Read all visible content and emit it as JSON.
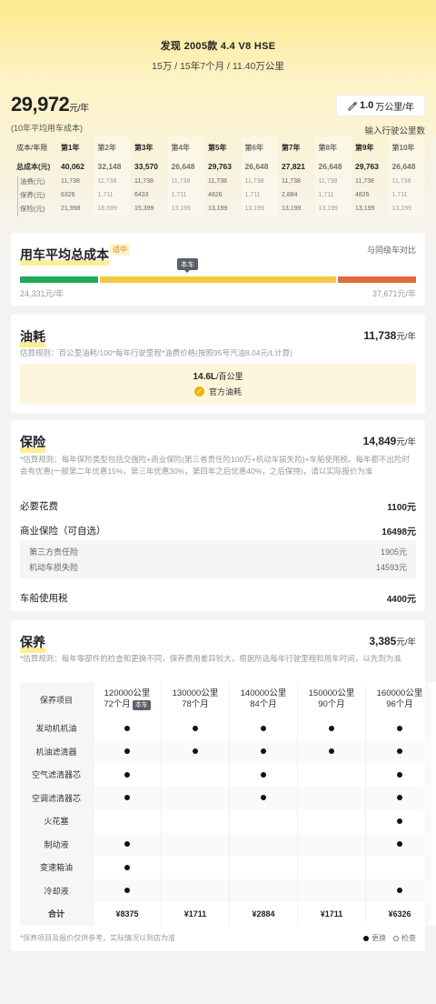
{
  "header": {
    "title": "发现 2005款 4.4 V8 HSE",
    "subtitle": "15万 / 15年7个月 / 11.40万公里"
  },
  "summary": {
    "total_cost": "29,972",
    "total_unit": "元/年",
    "note": "(10年平均用车成本)",
    "km_value": "1.0",
    "km_unit": "万公里/年",
    "km_hint": "输入行驶公里数"
  },
  "year_table": {
    "corner": "成本/年限",
    "years": [
      "第1年",
      "第2年",
      "第3年",
      "第4年",
      "第5年",
      "第6年",
      "第7年",
      "第8年",
      "第9年",
      "第10年"
    ],
    "rows": [
      {
        "label": "总成本(元)",
        "values": [
          "40,062",
          "32,148",
          "33,570",
          "26,648",
          "29,763",
          "26,648",
          "27,821",
          "26,648",
          "29,763",
          "26,648"
        ]
      },
      {
        "label": "油费(元)",
        "values": [
          "11,738",
          "11,738",
          "11,738",
          "11,738",
          "11,738",
          "11,738",
          "11,738",
          "11,738",
          "11,738",
          "11,738"
        ]
      },
      {
        "label": "保养(元)",
        "values": [
          "6326",
          "1,711",
          "6433",
          "1,711",
          "4826",
          "1,711",
          "2,884",
          "1,711",
          "4826",
          "1,711"
        ]
      },
      {
        "label": "保险(元)",
        "values": [
          "21,998",
          "18,699",
          "15,399",
          "13,199",
          "13,199",
          "13,199",
          "13,199",
          "13,199",
          "13,199",
          "13,199"
        ]
      }
    ]
  },
  "avg_card": {
    "title": "用车平均总成本",
    "tag": "适中",
    "compare": "与同级车对比",
    "current_chip": "本车",
    "low": "24,331元/年",
    "high": "37,671元/年",
    "colors": {
      "low": "#22a85a",
      "mid": "#f5c842",
      "high": "#e06a3a"
    },
    "position": 0.44
  },
  "fuel_card": {
    "title": "油耗",
    "value": "11,738",
    "unit": "元/年",
    "rule": "估算规则：百公里油耗/100*每年行驶里程*油费价格(按照95号汽油8.04元/L计算)",
    "consumption": "14.6L",
    "consumption_unit": "/百公里",
    "official": "官方油耗"
  },
  "insurance_card": {
    "title": "保险",
    "value": "14,849",
    "unit": "元/年",
    "rule": "*估算规则：每年保险类型包括交强险+商业保险(第三者责任险100万+机动车损失险)+车船使用税。每年都不出险时会有优惠(一般第二年优惠15%，第三年优惠30%，第四年之后优惠40%，之后保持)，请以实际报价为准",
    "required_label": "必要花费",
    "required_value": "1100元",
    "commercial_label": "商业保险（可自选）",
    "commercial_value": "16498元",
    "third_party_label": "第三方责任险",
    "third_party_value": "1905元",
    "damage_label": "机动车损失险",
    "damage_value": "14593元",
    "tax_label": "车船使用税",
    "tax_value": "4400元"
  },
  "maint_card": {
    "title": "保养",
    "value": "3,385",
    "unit": "元/年",
    "rule": "*估算规则：每年零部件的检查和更换不同，保养费用差异较大，根据所选每年行驶里程和用车时间，以先到为准",
    "corner": "保养项目",
    "current_tag": "本车",
    "columns": [
      {
        "km": "120000公里",
        "months": "72个月"
      },
      {
        "km": "130000公里",
        "months": "78个月"
      },
      {
        "km": "140000公里",
        "months": "84个月"
      },
      {
        "km": "150000公里",
        "months": "90个月"
      },
      {
        "km": "160000公里",
        "months": "96个月"
      }
    ],
    "items": [
      {
        "name": "发动机机油",
        "marks": [
          1,
          1,
          1,
          1,
          1
        ]
      },
      {
        "name": "机油滤清器",
        "marks": [
          1,
          1,
          1,
          1,
          1
        ]
      },
      {
        "name": "空气滤清器芯",
        "marks": [
          1,
          0,
          1,
          0,
          1
        ]
      },
      {
        "name": "空调滤清器芯",
        "marks": [
          1,
          0,
          1,
          0,
          1
        ]
      },
      {
        "name": "火花塞",
        "marks": [
          0,
          0,
          0,
          0,
          1
        ]
      },
      {
        "name": "制动液",
        "marks": [
          1,
          0,
          0,
          0,
          1
        ]
      },
      {
        "name": "变速箱油",
        "marks": [
          1,
          0,
          0,
          0,
          0
        ]
      },
      {
        "name": "冷却液",
        "marks": [
          1,
          0,
          0,
          0,
          1
        ]
      }
    ],
    "total_label": "合计",
    "totals": [
      "¥8375",
      "¥1711",
      "¥2884",
      "¥1711",
      "¥6326"
    ],
    "footnote": "*保养项目及报价仅供参考，实际情况以到店为准",
    "legend_replace": "更换",
    "legend_check": "检查"
  }
}
